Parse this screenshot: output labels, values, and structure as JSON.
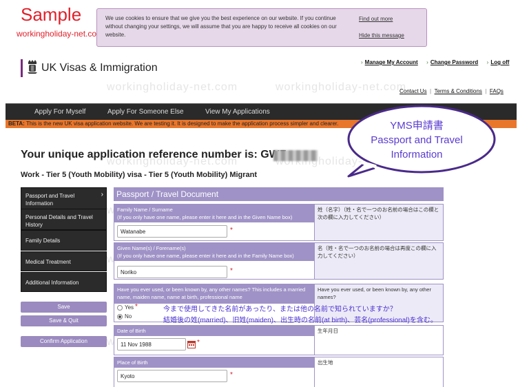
{
  "overlay": {
    "sample_label": "Sample",
    "sample_site": "workingholiday-net.com",
    "watermark": "workingholiday-net.com"
  },
  "cookie": {
    "text": "We use cookies to ensure that we give you the best experience on our website. If you continue without changing your settings, we will assume that you are happy to receive all cookies on our website.",
    "find_out_more": "Find out more",
    "hide": "Hide this message"
  },
  "header": {
    "brand": "UK Visas & Immigration",
    "account_links": [
      "Manage My Account",
      "Change Password",
      "Log off"
    ],
    "utility_links": [
      "Contact Us",
      "Terms & Conditions",
      "FAQs"
    ],
    "separator": "|"
  },
  "nav": {
    "items": [
      "Apply For Myself",
      "Apply For Someone Else",
      "View My Applications"
    ]
  },
  "beta": {
    "label": "BETA:",
    "text": "This is the new UK visa application website. We are testing it. It is designed to make the application process simpler and clearer."
  },
  "application": {
    "reference_label": "Your unique application reference number is: GWF",
    "visa_type": "Work - Tier 5 (Youth Mobility) visa - Tier 5 (Youth Mobility) Migrant"
  },
  "sidebar": {
    "items": [
      "Passport and Travel Information",
      "Personal Details and Travel History",
      "Family Details",
      "Medical Treatment",
      "Additional Information"
    ],
    "save": "Save",
    "save_quit": "Save & Quit",
    "confirm": "Confirm Application"
  },
  "form": {
    "title": "Passport / Travel Document",
    "family_name": {
      "label": "Family Name / Surname",
      "help": "(If you only have one name, please enter it here and in the Given Name box)",
      "value": "Watanabe",
      "jp": "姓（名字）（姓・名で一つのお名前の場合はこの欄と次の欄に入力してください）"
    },
    "given_name": {
      "label": "Given Name(s) / Forename(s)",
      "help": "(If you only have one name, please enter it here and in the Family Name box)",
      "value": "Noriko",
      "jp": "名（姓・名で一つのお名前の場合は再度この欄に入力してください）"
    },
    "other_names": {
      "label": "Have you ever used, or been known by, any other names? This includes a married name, maiden name, name at birth, professional name",
      "options": [
        "Yes",
        "No"
      ],
      "selected": "No",
      "jp": "Have you ever used, or been known by, any other names?"
    },
    "dob": {
      "label": "Date of Birth",
      "value": "11 Nov 1988",
      "jp": "生年月日"
    },
    "place_of_birth": {
      "label": "Place of Birth",
      "value": "Kyoto",
      "jp": "出生地"
    },
    "required_mark": "*"
  },
  "annotation": {
    "bubble_lines": [
      "YMS申請書",
      "Passport and Travel",
      "Information"
    ],
    "note_line1": "今まで使用してきた名前があったり、または他の名前で知られていますか？",
    "note_line2": "結婚後の姓(married)、旧姓(maiden)、出生時の名前(at birth)、芸名(professional)を含む。",
    "colors": {
      "accent": "#5a3bd0",
      "nav": "#2a2a2a",
      "beta": "#e8762b",
      "form_header": "#9f92c6"
    }
  }
}
